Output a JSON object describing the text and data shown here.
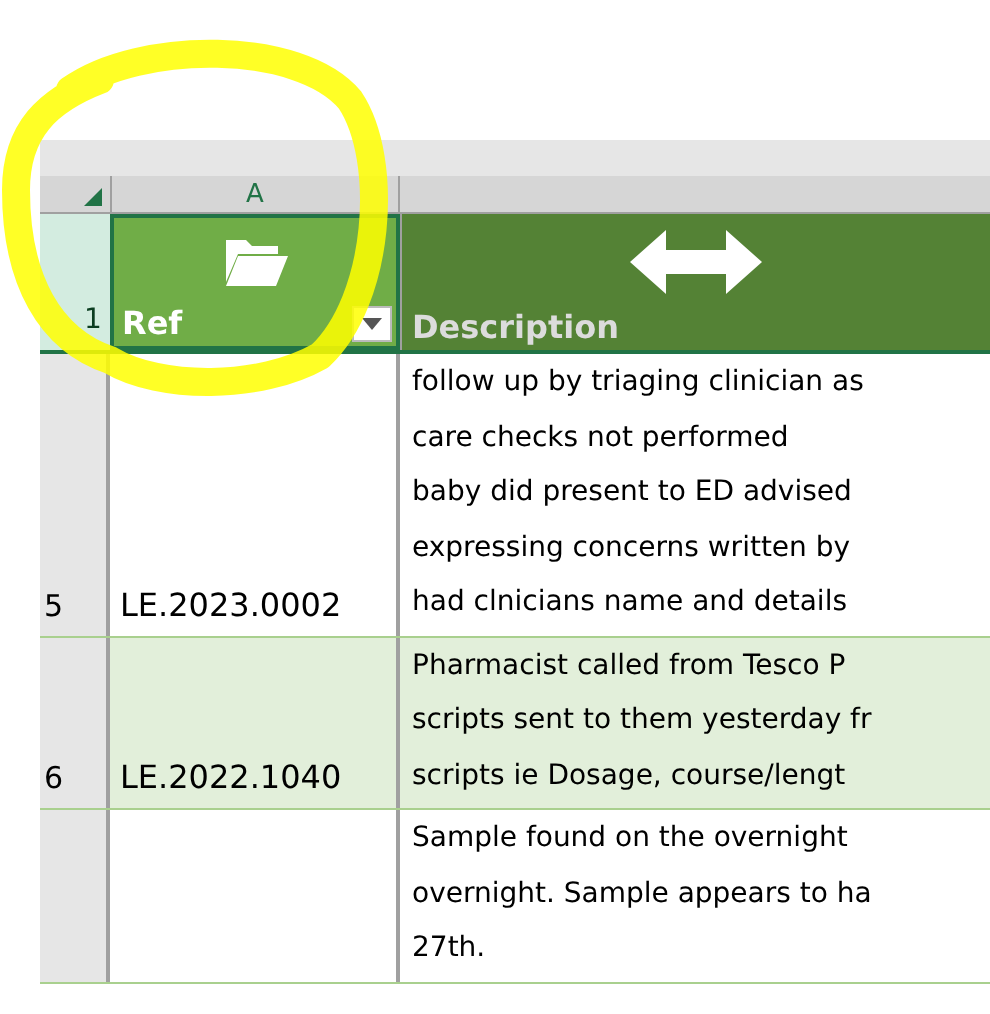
{
  "column_headers": [
    "A"
  ],
  "header_row": {
    "row_number": "1",
    "cells": [
      {
        "label": "Ref",
        "kind": "folder"
      },
      {
        "label": "Description",
        "kind": "arrows"
      }
    ]
  },
  "rows": [
    {
      "row_number": "5",
      "selected": false,
      "ref": "LE.2023.0002",
      "description": [
        "follow up by triaging clinician as",
        "care checks not performed",
        "baby did present to ED advised",
        "expressing concerns written by",
        "had clnicians name and details"
      ]
    },
    {
      "row_number": "6",
      "selected": true,
      "ref": "LE.2022.1040",
      "description": [
        "Pharmacist called from Tesco P",
        "scripts sent to them yesterday fr",
        "scripts ie Dosage, course/lengt"
      ]
    },
    {
      "selected": false,
      "description": [
        "Sample found on the overnight",
        "overnight. Sample appears to ha",
        "27th."
      ]
    }
  ],
  "annotation": {
    "kind": "circle"
  }
}
